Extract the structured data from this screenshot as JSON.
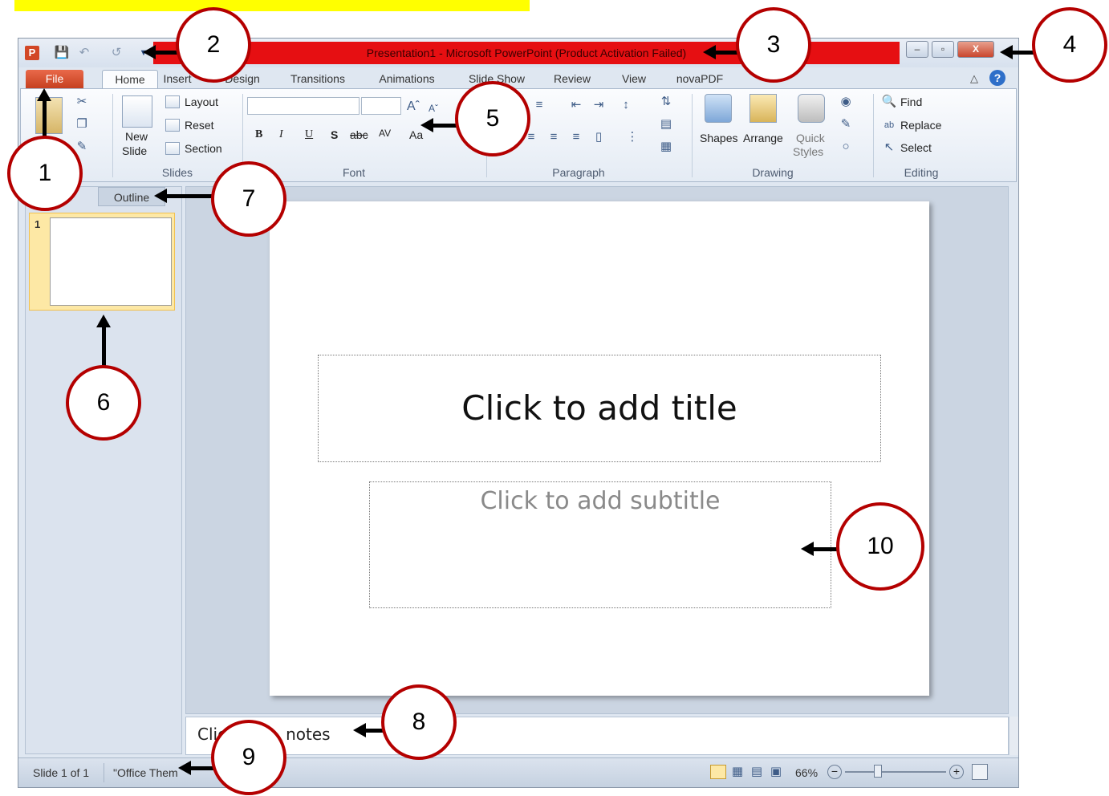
{
  "window": {
    "title": "Presentation1  -  Microsoft PowerPoint (Product Activation Failed)"
  },
  "quick_access": [
    "powerpoint-logo",
    "save-icon",
    "undo-icon",
    "redo-icon",
    "customize-arrow"
  ],
  "window_controls": {
    "minimize": "–",
    "restore": "▫",
    "close": "X"
  },
  "ribbon_tabs": [
    "File",
    "Home",
    "Insert",
    "Design",
    "Transitions",
    "Animations",
    "Slide Show",
    "Review",
    "View",
    "novaPDF"
  ],
  "active_tab": "Home",
  "ribbon": {
    "slides": {
      "label": "Slides",
      "new_slide_line1": "New",
      "new_slide_line2": "Slide",
      "layout": "Layout",
      "reset": "Reset",
      "section": "Section"
    },
    "font": {
      "label": "Font",
      "font_name": "",
      "font_size": "",
      "bold": "B",
      "italic": "I",
      "underline": "U",
      "shadow": "S",
      "strike": "abc",
      "spacing": "AV",
      "case": "Aa"
    },
    "paragraph": {
      "label": "Paragraph"
    },
    "drawing": {
      "label": "Drawing",
      "shapes": "Shapes",
      "arrange": "Arrange",
      "quick_line1": "Quick",
      "quick_line2": "Styles"
    },
    "editing": {
      "label": "Editing",
      "find": "Find",
      "replace": "Replace",
      "select": "Select"
    }
  },
  "left_pane": {
    "outline_tab": "Outline",
    "slide_number": "1"
  },
  "slide": {
    "title_placeholder": "Click to add title",
    "subtitle_placeholder": "Click to add subtitle"
  },
  "notes": {
    "placeholder_visible_start": "Clic",
    "placeholder_visible_end": "notes"
  },
  "status": {
    "slide_of": "Slide 1 of 1",
    "theme": "\"Office Them",
    "zoom": "66%"
  },
  "callouts": [
    "1",
    "2",
    "3",
    "4",
    "5",
    "6",
    "7",
    "8",
    "9",
    "10"
  ],
  "colors": {
    "title_bar_red": "#e60f12",
    "file_tab": "#d24726",
    "callout_border": "#b40000",
    "highlight_yellow": "#ffff00",
    "slide_selected": "#fde8a5"
  }
}
